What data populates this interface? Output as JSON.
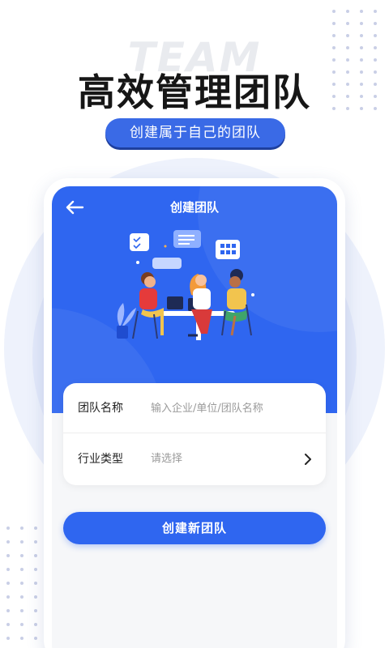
{
  "banner": {
    "watermark": "TEAM",
    "headline": "高效管理团队",
    "subtitle": "创建属于自己的团队"
  },
  "screen": {
    "nav_title": "创建团队",
    "back_icon": "arrow-left-icon",
    "form": {
      "team_name": {
        "label": "团队名称",
        "placeholder": "输入企业/单位/团队名称",
        "value": ""
      },
      "industry": {
        "label": "行业类型",
        "value": "请选择",
        "icon": "chevron-right-icon"
      }
    },
    "create_button": "创建新团队"
  },
  "colors": {
    "primary": "#2f66f0",
    "pill": "#3a6ae6",
    "headline": "#161616",
    "background": "#f6f7f9"
  }
}
